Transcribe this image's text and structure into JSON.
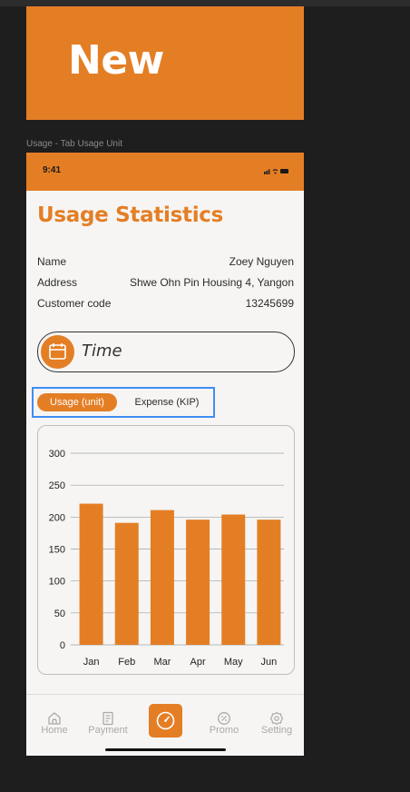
{
  "banner": {
    "label": "New",
    "color": "#E47E25"
  },
  "frame_label": "Usage - Tab Usage Unit",
  "status_bar": {
    "time": "9:41"
  },
  "page_title": "Usage Statistics",
  "info": [
    {
      "key": "Name",
      "value": "Zoey Nguyen"
    },
    {
      "key": "Address",
      "value": "Shwe Ohn Pin Housing 4, Yangon"
    },
    {
      "key": "Customer code",
      "value": "13245699"
    }
  ],
  "time_selector": {
    "label": "Time",
    "icon": "calendar-icon"
  },
  "tabs": [
    {
      "label": "Usage (unit)",
      "active": true
    },
    {
      "label": "Expense (KIP)",
      "active": false
    }
  ],
  "chart_data": {
    "type": "bar",
    "categories": [
      "Jan",
      "Feb",
      "Mar",
      "Apr",
      "May",
      "Jun"
    ],
    "values": [
      221,
      191,
      211,
      196,
      204,
      196
    ],
    "ylim": [
      0,
      300
    ],
    "yticks": [
      0,
      50,
      100,
      150,
      200,
      250,
      300
    ],
    "grid": true,
    "bar_color": "#E47E25"
  },
  "bottom_nav": [
    {
      "label": "Home",
      "icon": "home-icon"
    },
    {
      "label": "Payment",
      "icon": "receipt-icon"
    },
    {
      "label": "",
      "icon": "gauge-icon",
      "active": true
    },
    {
      "label": "Promo",
      "icon": "discount-icon"
    },
    {
      "label": "Setting",
      "icon": "gear-icon"
    }
  ]
}
